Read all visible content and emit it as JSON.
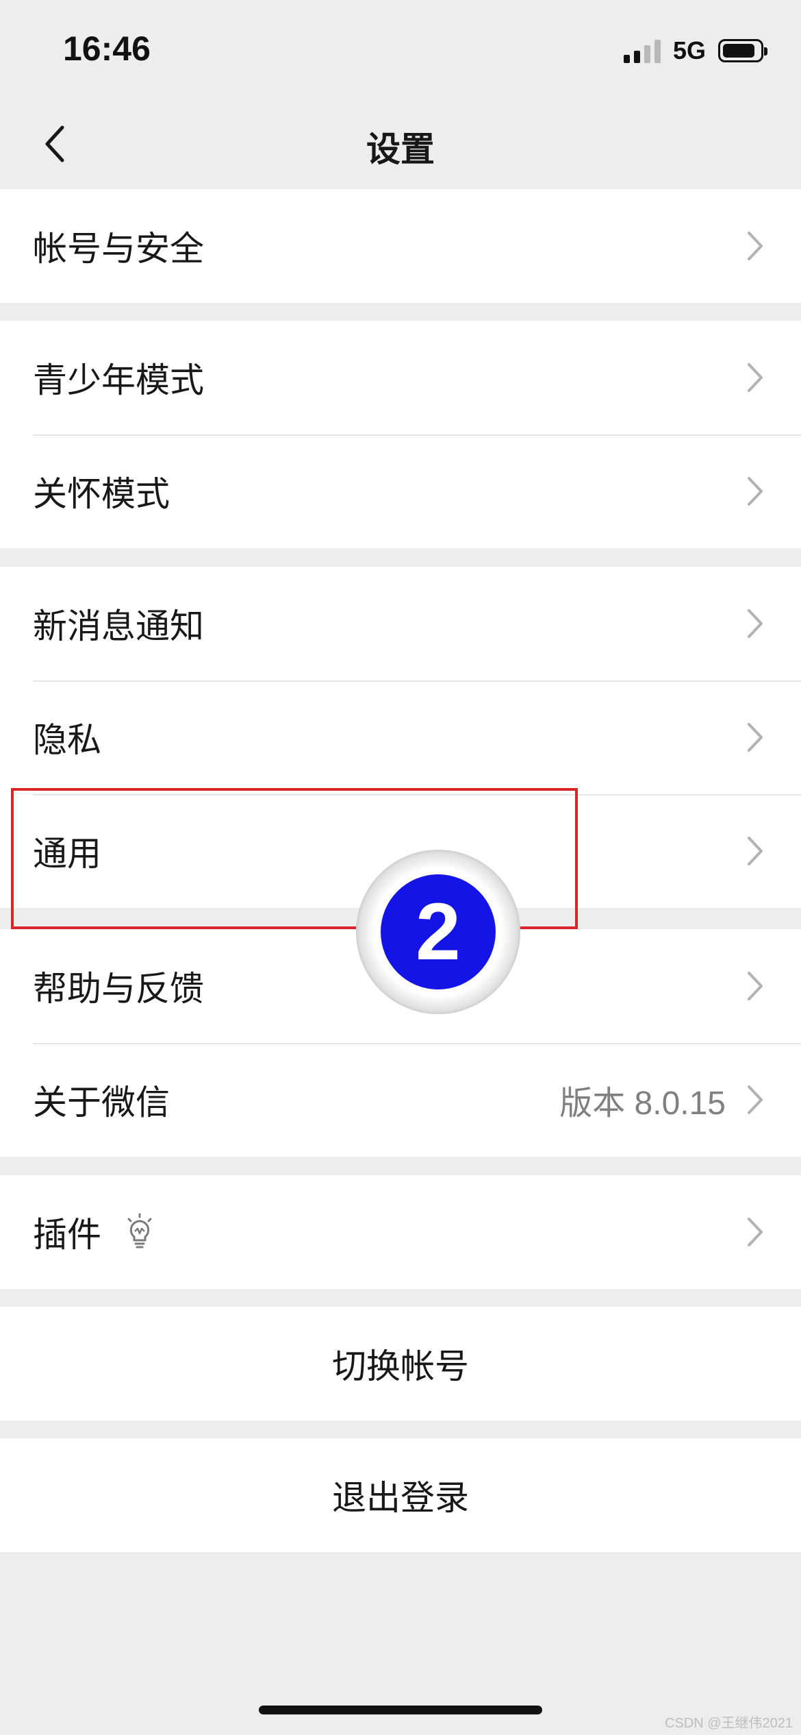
{
  "status_bar": {
    "time": "16:46",
    "network": "5G",
    "signal_bars_active": 2,
    "signal_bars_total": 4,
    "battery_level": 0.8
  },
  "nav": {
    "title": "设置",
    "back_icon": "chevron-left-icon"
  },
  "groups": [
    {
      "items": [
        {
          "label": "帐号与安全"
        }
      ]
    },
    {
      "items": [
        {
          "label": "青少年模式"
        },
        {
          "label": "关怀模式"
        }
      ]
    },
    {
      "items": [
        {
          "label": "新消息通知"
        },
        {
          "label": "隐私"
        },
        {
          "label": "通用"
        }
      ]
    },
    {
      "items": [
        {
          "label": "帮助与反馈"
        },
        {
          "label": "关于微信",
          "value": "版本 8.0.15"
        }
      ]
    },
    {
      "items": [
        {
          "label": "插件",
          "icon": "lightbulb-icon"
        }
      ]
    }
  ],
  "actions": {
    "switch_account": "切换帐号",
    "logout": "退出登录"
  },
  "annotation": {
    "step_number": "2",
    "highlight_color": "#D7262C",
    "badge_color": "#1414E6"
  },
  "watermark": "CSDN @王继伟2021",
  "colors": {
    "background": "#EDEDED",
    "card": "#FFFFFF",
    "text": "#181818",
    "secondary_text": "#808080"
  }
}
